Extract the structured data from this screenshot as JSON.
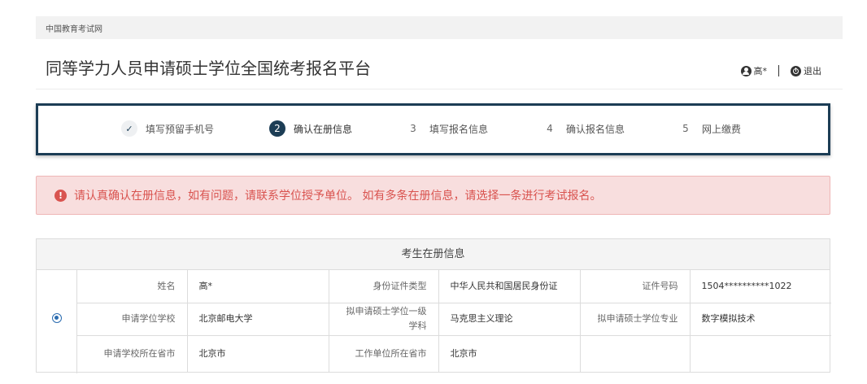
{
  "site": {
    "name": "中国教育考试网"
  },
  "header": {
    "title": "同等学力人员申请硕士学位全国统考报名平台",
    "user": "高*",
    "logout": "退出"
  },
  "steps": [
    {
      "num": "✓",
      "label": "填写预留手机号",
      "state": "done"
    },
    {
      "num": "2",
      "label": "确认在册信息",
      "state": "active"
    },
    {
      "num": "3",
      "label": "填写报名信息",
      "state": "todo"
    },
    {
      "num": "4",
      "label": "确认报名信息",
      "state": "todo"
    },
    {
      "num": "5",
      "label": "网上缴费",
      "state": "todo"
    }
  ],
  "alert": {
    "icon": "!",
    "text": "请认真确认在册信息，如有问题，请联系学位授予单位。 如有多条在册信息，请选择一条进行考试报名。"
  },
  "card": {
    "title": "考生在册信息",
    "rows": [
      [
        {
          "label": "姓名",
          "value": "高*"
        },
        {
          "label": "身份证件类型",
          "value": "中华人民共和国居民身份证"
        },
        {
          "label": "证件号码",
          "value": "1504**********1022"
        }
      ],
      [
        {
          "label": "申请学位学校",
          "value": "北京邮电大学"
        },
        {
          "label": "拟申请硕士学位一级学科",
          "value": "马克思主义理论"
        },
        {
          "label": "拟申请硕士学位专业",
          "value": "数字模拟技术"
        }
      ],
      [
        {
          "label": "申请学校所在省市",
          "value": "北京市"
        },
        {
          "label": "工作单位所在省市",
          "value": "北京市"
        },
        {
          "label": "",
          "value": ""
        }
      ]
    ]
  },
  "colors": {
    "primary": "#1c3d55",
    "alert_text": "#d9534f",
    "alert_bg": "#f8dede",
    "radio": "#2b6cb0"
  }
}
